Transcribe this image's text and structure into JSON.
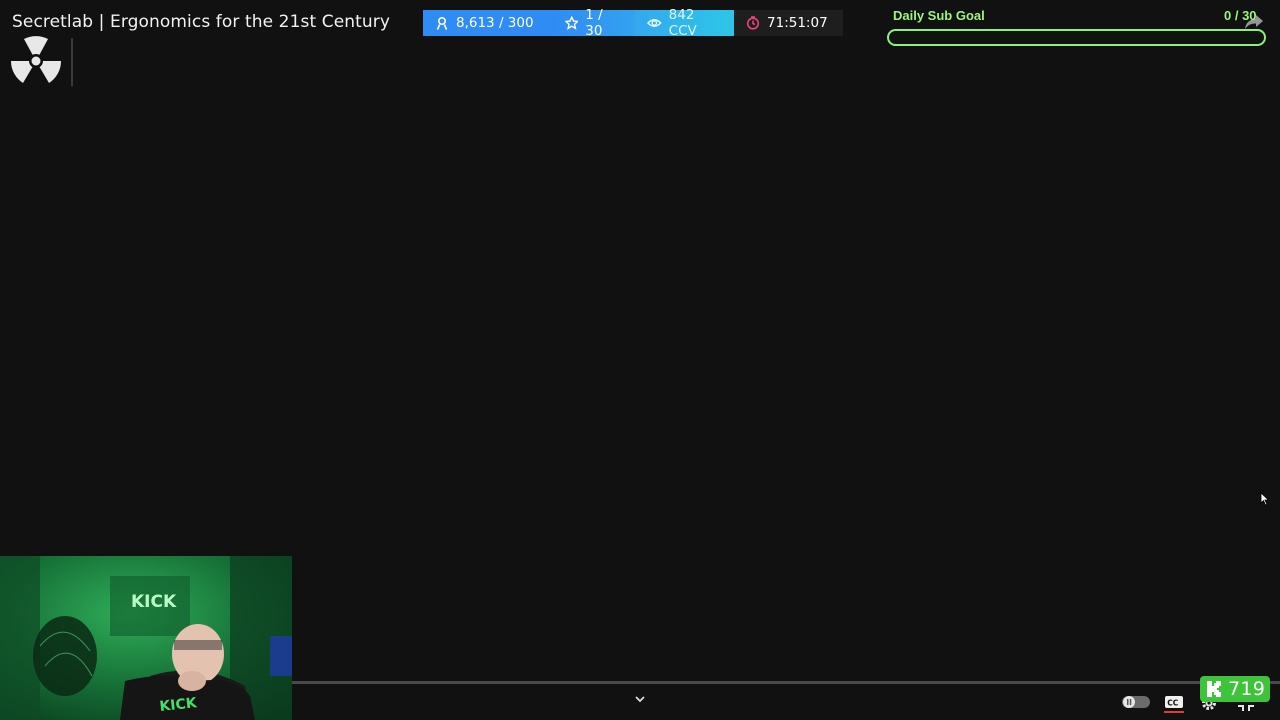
{
  "stream": {
    "title": "Secretlab | Ergonomics for the 21st Century"
  },
  "stats": {
    "followers": "8,613 / 300",
    "subs": "1 / 30",
    "ccv": "842 CCV",
    "timer": "71:51:07"
  },
  "goal": {
    "label": "Daily Sub Goal",
    "count": "0 / 30",
    "progress": 0
  },
  "webcam": {
    "banner_text": "KICK",
    "shirt_text": "KICK"
  },
  "kick": {
    "viewer_count": "719"
  },
  "colors": {
    "goal_green": "#8ef07a",
    "kick_green": "#3ec43a",
    "stat_blue": "#2f8cf4",
    "stat_cyan": "#2ec6e8",
    "timer_pink": "#e8437a"
  },
  "icons": [
    "radiation-logo-icon",
    "user-icon",
    "star-icon",
    "eye-icon",
    "clock-icon",
    "share-icon",
    "chevron-down-icon",
    "pause-toggle-icon",
    "cc-icon",
    "gear-icon",
    "fullscreen-icon",
    "kick-k-icon"
  ]
}
